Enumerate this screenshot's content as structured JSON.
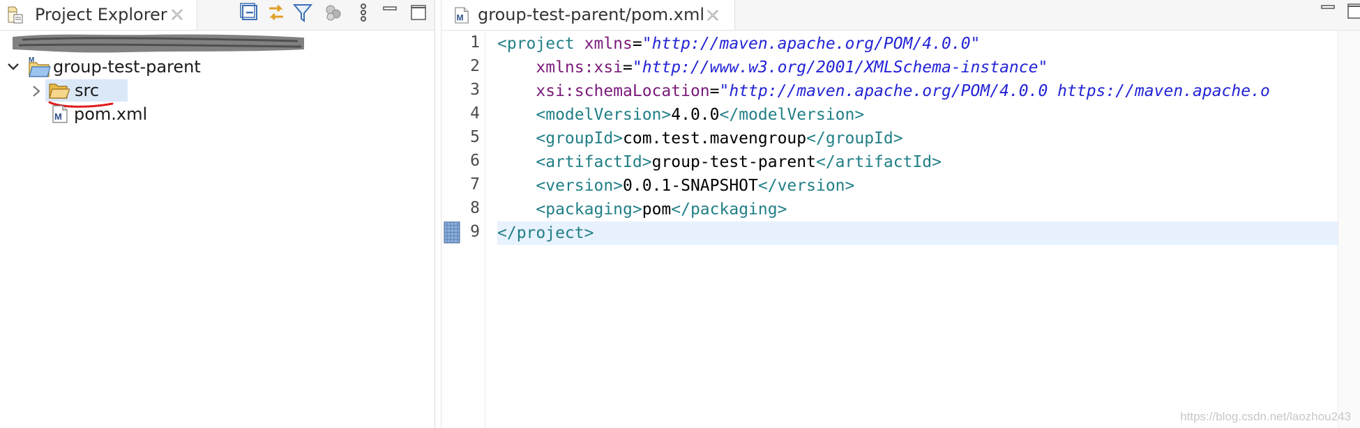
{
  "explorer": {
    "tab_label": "Project Explorer",
    "tree": {
      "project": "group-test-parent",
      "folder": "src",
      "file": "pom.xml"
    }
  },
  "editor": {
    "tab_label": "group-test-parent/pom.xml",
    "lines": [
      {
        "n": "1",
        "parts": [
          [
            "tag",
            "<project "
          ],
          [
            "attr",
            "xmlns"
          ],
          [
            "txt",
            "="
          ],
          [
            "str",
            "\"http://maven.apache.org/POM/4.0.0\""
          ]
        ]
      },
      {
        "n": "2",
        "parts": [
          [
            "txt",
            "    "
          ],
          [
            "attr",
            "xmlns:xsi"
          ],
          [
            "txt",
            "="
          ],
          [
            "str",
            "\"http://www.w3.org/2001/XMLSchema-instance\""
          ]
        ]
      },
      {
        "n": "3",
        "parts": [
          [
            "txt",
            "    "
          ],
          [
            "attr",
            "xsi:schemaLocation"
          ],
          [
            "txt",
            "="
          ],
          [
            "str",
            "\"http://maven.apache.org/POM/4.0.0 https://maven.apache.o"
          ]
        ]
      },
      {
        "n": "4",
        "parts": [
          [
            "txt",
            "    "
          ],
          [
            "tag",
            "<modelVersion>"
          ],
          [
            "txt",
            "4.0.0"
          ],
          [
            "tag",
            "</modelVersion>"
          ]
        ]
      },
      {
        "n": "5",
        "parts": [
          [
            "txt",
            "    "
          ],
          [
            "tag",
            "<groupId>"
          ],
          [
            "txt",
            "com.test.mavengroup"
          ],
          [
            "tag",
            "</groupId>"
          ]
        ]
      },
      {
        "n": "6",
        "parts": [
          [
            "txt",
            "    "
          ],
          [
            "tag",
            "<artifactId>"
          ],
          [
            "txt",
            "group-test-parent"
          ],
          [
            "tag",
            "</artifactId>"
          ]
        ]
      },
      {
        "n": "7",
        "parts": [
          [
            "txt",
            "    "
          ],
          [
            "tag",
            "<version>"
          ],
          [
            "txt",
            "0.0.1-SNAPSHOT"
          ],
          [
            "tag",
            "</version>"
          ]
        ]
      },
      {
        "n": "8",
        "parts": [
          [
            "txt",
            "    "
          ],
          [
            "tag",
            "<packaging>"
          ],
          [
            "txt",
            "pom"
          ],
          [
            "tag",
            "</packaging>"
          ]
        ]
      },
      {
        "n": "9",
        "parts": [
          [
            "tag",
            "</project>"
          ]
        ]
      }
    ],
    "current_line": 9
  },
  "watermark": "https://blog.csdn.net/laozhou243",
  "colors": {
    "tag": "#217f86",
    "attribute": "#7a1a7a",
    "string": "#2323d6",
    "selection": "#dbe8f8",
    "current_line": "#e8f2fe"
  }
}
